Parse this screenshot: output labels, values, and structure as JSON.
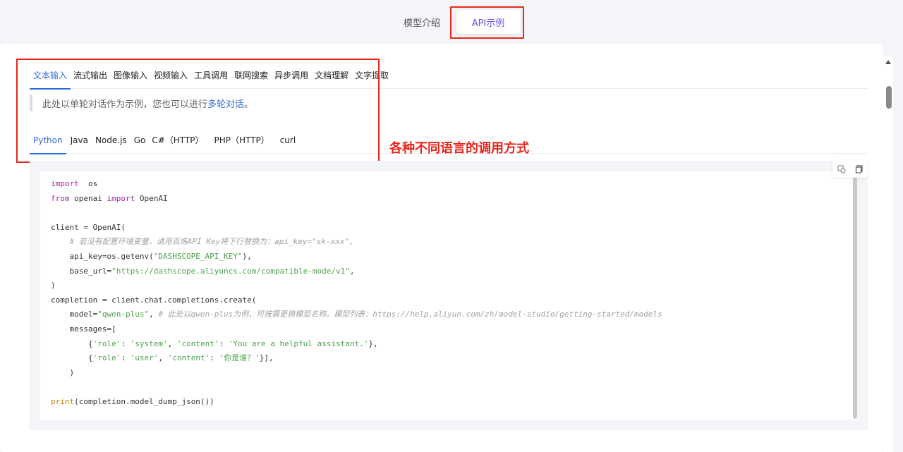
{
  "top_tabs": [
    {
      "label": "模型介绍",
      "active": false
    },
    {
      "label": "API示例",
      "active": true
    }
  ],
  "sub_tabs": [
    {
      "label": "文本输入",
      "active": true
    },
    {
      "label": "流式输出",
      "active": false
    },
    {
      "label": "图像输入",
      "active": false
    },
    {
      "label": "视频输入",
      "active": false
    },
    {
      "label": "工具调用",
      "active": false
    },
    {
      "label": "联网搜索",
      "active": false
    },
    {
      "label": "异步调用",
      "active": false
    },
    {
      "label": "文档理解",
      "active": false
    },
    {
      "label": "文字提取",
      "active": false
    }
  ],
  "note": {
    "prefix": "此处以单轮对话作为示例，您也可以进行",
    "link": "多轮对话",
    "suffix": "。"
  },
  "lang_tabs": [
    {
      "label": "Python",
      "active": true
    },
    {
      "label": "Java",
      "active": false
    },
    {
      "label": "Node.js",
      "active": false
    },
    {
      "label": "Go",
      "active": false
    },
    {
      "label": "C#（HTTP）",
      "active": false
    },
    {
      "label": "PHP（HTTP）",
      "active": false
    },
    {
      "label": "curl",
      "active": false
    }
  ],
  "annotation": "各种不同语言的调用方式",
  "code_lines": [
    [
      [
        "kw",
        "import"
      ],
      [
        "",
        "  os"
      ]
    ],
    [
      [
        "kw",
        "from"
      ],
      [
        "",
        " openai "
      ],
      [
        "kw",
        "import"
      ],
      [
        "",
        " OpenAI"
      ]
    ],
    [],
    [
      [
        "",
        "client = OpenAI("
      ]
    ],
    [
      [
        "",
        "    "
      ],
      [
        "cmt",
        "# 若没有配置环境变量，请用百炼API Key将下行替换为：api_key=\"sk-xxx\","
      ]
    ],
    [
      [
        "",
        "    api_key=os.getenv("
      ],
      [
        "str",
        "\"DASHSCOPE_API_KEY\""
      ],
      [
        "",
        "),"
      ]
    ],
    [
      [
        "",
        "    base_url="
      ],
      [
        "str",
        "\"https://dashscope.aliyuncs.com/compatible-mode/v1\""
      ],
      [
        "",
        ","
      ]
    ],
    [
      [
        "",
        ")"
      ]
    ],
    [
      [
        "",
        "completion = client.chat.completions.create("
      ]
    ],
    [
      [
        "",
        "    model="
      ],
      [
        "str",
        "\"qwen-plus\""
      ],
      [
        "",
        ", "
      ],
      [
        "cmt",
        "# 此处以qwen-plus为例，可按需更换模型名称。模型列表：https://help.aliyun.com/zh/model-studio/getting-started/models"
      ]
    ],
    [
      [
        "",
        "    messages=["
      ]
    ],
    [
      [
        "",
        "        {"
      ],
      [
        "str",
        "'role'"
      ],
      [
        "",
        ": "
      ],
      [
        "str",
        "'system'"
      ],
      [
        "",
        ", "
      ],
      [
        "str",
        "'content'"
      ],
      [
        "",
        ": "
      ],
      [
        "str",
        "'You are a helpful assistant.'"
      ],
      [
        "",
        "},"
      ]
    ],
    [
      [
        "",
        "        {"
      ],
      [
        "str",
        "'role'"
      ],
      [
        "",
        ": "
      ],
      [
        "str",
        "'user'"
      ],
      [
        "",
        ", "
      ],
      [
        "str",
        "'content'"
      ],
      [
        "",
        ": "
      ],
      [
        "str",
        "'你是谁？'"
      ],
      [
        "",
        "}],"
      ]
    ],
    [
      [
        "",
        "    )"
      ]
    ],
    [],
    [
      [
        "fn",
        "print"
      ],
      [
        "",
        "(completion.model_dump_json())"
      ]
    ]
  ]
}
